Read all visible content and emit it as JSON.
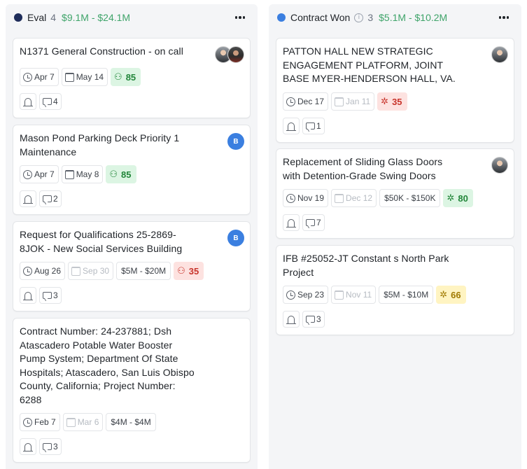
{
  "columns": [
    {
      "title": "Eval",
      "count": "4",
      "range": "$9.1M - $24.1M",
      "dot_color": "#1f2d5a",
      "cards": [
        {
          "title": "N1371 General Construction - on call",
          "start": "Apr 7",
          "due": "May 14",
          "value": "",
          "score": "85",
          "score_kind": "green",
          "comments": "4",
          "avatar": "photos"
        },
        {
          "title": "Mason Pond Parking Deck Priority 1 Maintenance",
          "start": "Apr 7",
          "due": "May 8",
          "value": "",
          "score": "85",
          "score_kind": "green",
          "comments": "2",
          "avatar": "B"
        },
        {
          "title": "Request for Qualifications 25-2869-8JOK - New Social Services Building",
          "start": "Aug 26",
          "due": "Sep 30",
          "value": "$5M - $20M",
          "score": "35",
          "score_kind": "red",
          "comments": "3",
          "avatar": "B"
        },
        {
          "title": "Contract Number: 24-237881; Dsh Atascadero Potable Water Booster Pump System; Department Of State Hospitals; Atascadero, San Luis Obispo County, California; Project Number: 6288",
          "start": "Feb 7",
          "due": "Mar 6",
          "value": "$4M - $4M",
          "score": "",
          "score_kind": "",
          "comments": "3",
          "avatar": ""
        }
      ]
    },
    {
      "title": "Contract Won",
      "count": "3",
      "range": "$5.1M - $10.2M",
      "dot_color": "#3b7fe0",
      "cards": [
        {
          "title": "PATTON HALL NEW STRATEGIC ENGAGEMENT PLATFORM, JOINT BASE MYER-HENDERSON HALL, VA.",
          "start": "Dec 17",
          "due": "Jan 11",
          "value": "",
          "score": "35",
          "score_kind": "red",
          "comments": "1",
          "avatar": "photo"
        },
        {
          "title": "Replacement of Sliding Glass Doors with Detention-Grade Swing Doors",
          "start": "Nov 19",
          "due": "Dec 12",
          "value": "$50K - $150K",
          "score": "80",
          "score_kind": "green",
          "comments": "7",
          "avatar": "photo"
        },
        {
          "title": "IFB #25052-JT Constant s North Park Project",
          "start": "Sep 23",
          "due": "Nov 11",
          "value": "$5M - $10M",
          "score": "66",
          "score_kind": "yellow",
          "comments": "3",
          "avatar": ""
        }
      ]
    }
  ],
  "avatar_letter": "B"
}
